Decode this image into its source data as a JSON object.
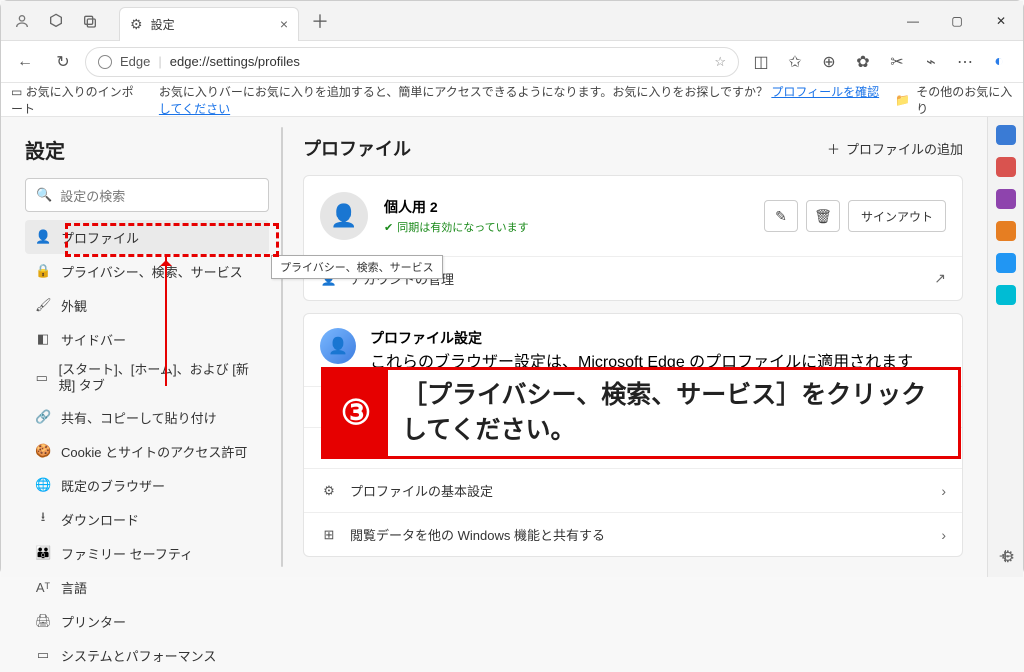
{
  "titlebar": {
    "tab_title": "設定"
  },
  "address": {
    "brand": "Edge",
    "url": "edge://settings/profiles"
  },
  "bookbar": {
    "import": "お気に入りのインポート",
    "hint_pre": "お気に入りバーにお気に入りを追加すると、簡単にアクセスできるようになります。お気に入りをお探しですか？ ",
    "hint_link": "プロフィールを確認してください",
    "other": "その他のお気に入り"
  },
  "settings": {
    "title": "設定",
    "search_placeholder": "設定の検索",
    "items": [
      {
        "icon": "👤",
        "label": "プロファイル"
      },
      {
        "icon": "🔒",
        "label": "プライバシー、検索、サービス"
      },
      {
        "icon": "🖌",
        "label": "外観"
      },
      {
        "icon": "◧",
        "label": "サイドバー"
      },
      {
        "icon": "▭",
        "label": "[スタート]、[ホーム]、および [新規] タブ"
      },
      {
        "icon": "🔗",
        "label": "共有、コピーして貼り付け"
      },
      {
        "icon": "🍪",
        "label": "Cookie とサイトのアクセス許可"
      },
      {
        "icon": "🌐",
        "label": "既定のブラウザー"
      },
      {
        "icon": "⭳",
        "label": "ダウンロード"
      },
      {
        "icon": "👪",
        "label": "ファミリー セーフティ"
      },
      {
        "icon": "Aᵀ",
        "label": "言語"
      },
      {
        "icon": "🖨",
        "label": "プリンター"
      },
      {
        "icon": "▭",
        "label": "システムとパフォーマンス"
      }
    ]
  },
  "tooltip": "プライバシー、検索、サービス",
  "main": {
    "title": "プロファイル",
    "add_profile": "プロファイルの追加",
    "profile": {
      "name": "個人用 2",
      "sub": " ",
      "sync": "同期は有効になっています",
      "signout": "サインアウト"
    },
    "rows": {
      "account": "アカウントの管理",
      "settings_title": "プロファイル設定",
      "settings_desc": "これらのブラウザー設定は、Microsoft Edge のプロファイルに適用されます",
      "hidden1": " ",
      "hidden2": " ",
      "basic": "プロファイルの基本設定",
      "windows": "閲覧データを他の Windows 機能と共有する"
    }
  },
  "annotation": {
    "num": "③",
    "text": "［プライバシー、検索、サービス］をクリックしてください。"
  }
}
